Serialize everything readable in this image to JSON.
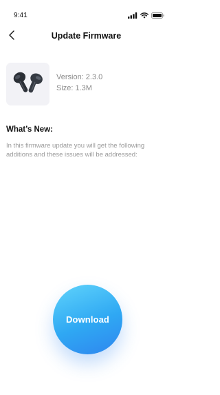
{
  "status_bar": {
    "time": "9:41",
    "icons": [
      "signal-icon",
      "wifi-icon",
      "battery-icon"
    ]
  },
  "header": {
    "back_icon": "chevron-left-icon",
    "title": "Update Firmware"
  },
  "product": {
    "image": "earbuds-image",
    "version_text": "Version: 2.3.0",
    "size_text": "Size: 1.3M"
  },
  "whats_new": {
    "heading": "What’s New:",
    "body": "In this firmware update you will get the following additions and these issues will be addressed:"
  },
  "download": {
    "label": "Download"
  },
  "colors": {
    "download_gradient_start": "#5fd3fb",
    "download_gradient_end": "#2f86ef",
    "thumb_bg": "#f2f2f6",
    "meta_text": "#8a8a8a",
    "body_text": "#9a9a9a"
  }
}
